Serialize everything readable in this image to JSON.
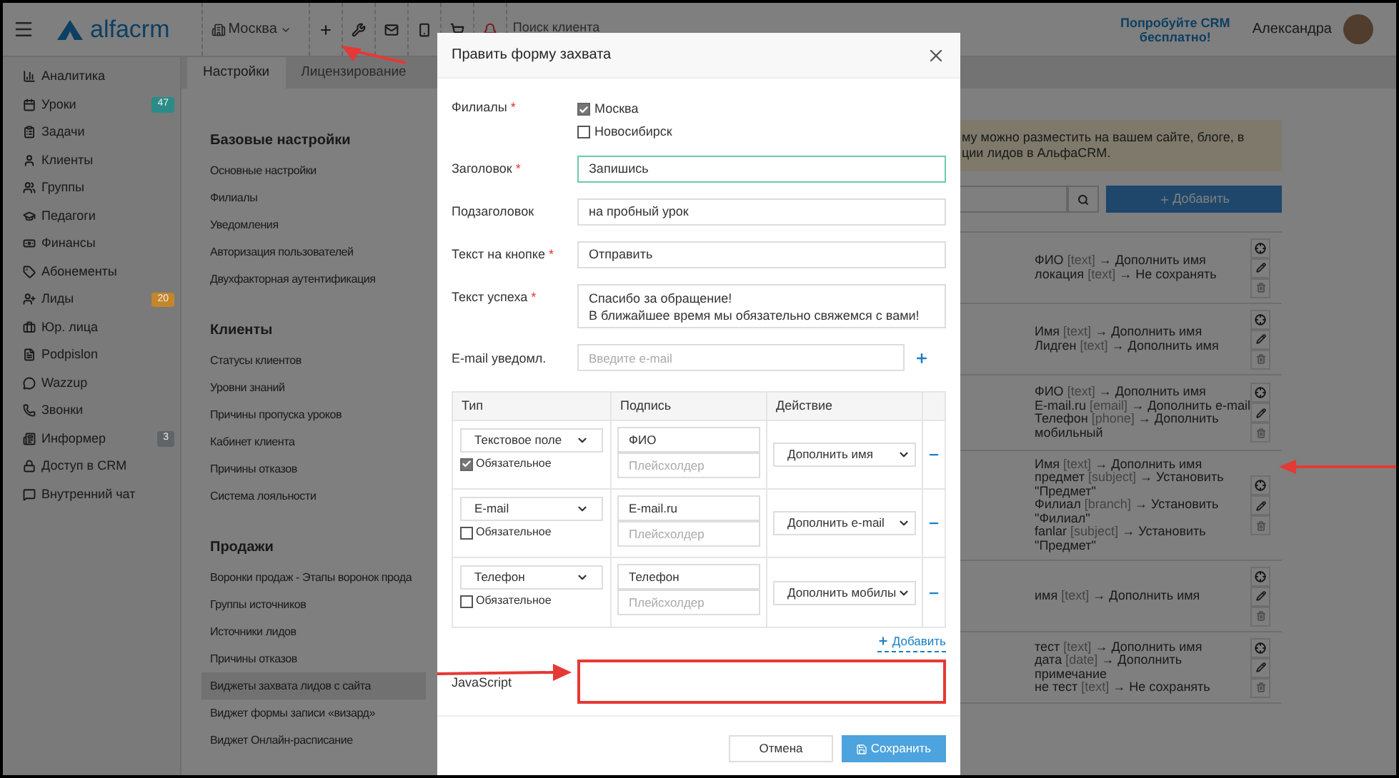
{
  "top_bar": {
    "logo": "alfacrm",
    "branch": "Москва",
    "search": {
      "placeholder": "Поиск клиента"
    },
    "promo": "Попробуйте CRM бесплатно!",
    "user": "Александра"
  },
  "sidebar": {
    "items": [
      {
        "label": "Аналитика"
      },
      {
        "label": "Уроки",
        "badge": "47",
        "color": "#2a8c86"
      },
      {
        "label": "Задачи"
      },
      {
        "label": "Клиенты"
      },
      {
        "label": "Группы"
      },
      {
        "label": "Педагоги"
      },
      {
        "label": "Финансы"
      },
      {
        "label": "Абонементы"
      },
      {
        "label": "Лиды",
        "badge": "20",
        "color": "#c5862a"
      },
      {
        "label": "Юр. лица"
      },
      {
        "label": "Podpislon"
      },
      {
        "label": "Wazzup"
      },
      {
        "label": "Звонки"
      },
      {
        "label": "Информер",
        "badge": "3",
        "color": "#5f6468"
      },
      {
        "label": "Доступ в CRM"
      },
      {
        "label": "Внутренний чат"
      }
    ]
  },
  "settings": {
    "tabs": [
      {
        "label": "Настройки",
        "selected": true
      },
      {
        "label": "Лицензирование",
        "selected": false
      }
    ],
    "sections": [
      {
        "title": "Базовые настройки",
        "items": [
          {
            "label": "Основные настройки",
            "selected": false
          },
          {
            "label": "Филиалы",
            "selected": false
          },
          {
            "label": "Уведомления",
            "selected": false
          },
          {
            "label": "Авторизация пользователей",
            "selected": false
          },
          {
            "label": "Двухфакторная аутентификация",
            "selected": false
          }
        ]
      },
      {
        "title": "Клиенты",
        "items": [
          {
            "label": "Статусы клиентов",
            "selected": false
          },
          {
            "label": "Уровни знаний",
            "selected": false
          },
          {
            "label": "Причины пропуска уроков",
            "selected": false
          },
          {
            "label": "Кабинет клиента",
            "selected": false
          },
          {
            "label": "Причины отказов",
            "selected": false
          },
          {
            "label": "Система лояльности",
            "selected": false
          }
        ]
      },
      {
        "title": "Продажи",
        "items": [
          {
            "label": "Воронки продаж - Этапы воронок прода",
            "selected": false
          },
          {
            "label": "Группы источников",
            "selected": false
          },
          {
            "label": "Источники лидов",
            "selected": false
          },
          {
            "label": "Причины отказов",
            "selected": false
          },
          {
            "label": "Виджеты захвата лидов с сайта",
            "selected": true
          },
          {
            "label": "Виджет формы записи «визард»",
            "selected": false
          },
          {
            "label": "Виджет Онлайн-расписание",
            "selected": false
          }
        ]
      }
    ]
  },
  "widgets": {
    "banner": [
      "му можно разместить на вашем сайте, блоге, в",
      "ции лидов в АльфаCRM."
    ],
    "add_button": "Добавить",
    "rows": [
      {
        "lines": [
          {
            "name": "ФИО",
            "type": "[text]",
            "action": "→ Дополнить имя"
          },
          {
            "name": "локация",
            "type": "[text]",
            "action": "→ Не сохранять"
          }
        ]
      },
      {
        "lines": [
          {
            "name": "Имя",
            "type": "[text]",
            "action": "→ Дополнить имя"
          },
          {
            "name": "Лидген",
            "type": "[text]",
            "action": "→ Дополнить имя"
          }
        ]
      },
      {
        "lines": [
          {
            "name": "ФИО",
            "type": "[text]",
            "action": "→ Дополнить имя"
          },
          {
            "name": "E-mail.ru",
            "type": "[email]",
            "action": "→ Дополнить e-mail"
          },
          {
            "name": "Телефон",
            "type": "[phone]",
            "action": "→ Дополнить мобильный"
          }
        ]
      },
      {
        "lines": [
          {
            "name": "Имя",
            "type": "[text]",
            "action": "→ Дополнить имя"
          },
          {
            "name": "предмет",
            "type": "[subject]",
            "action": "→ Установить \"Предмет\""
          },
          {
            "name": "Филиал",
            "type": "[branch]",
            "action": "→ Установить \"Филиал\""
          },
          {
            "name": "fanlar",
            "type": "[subject]",
            "action": "→ Установить \"Предмет\""
          }
        ]
      },
      {
        "lines": [
          {
            "name": "имя",
            "type": "[text]",
            "action": "→ Дополнить имя"
          }
        ]
      },
      {
        "lines": [
          {
            "name": "тест",
            "type": "[text]",
            "action": "→ Дополнить имя"
          },
          {
            "name": "дата",
            "type": "[date]",
            "action": "→ Дополнить примечание"
          },
          {
            "name": "не тест",
            "type": "[text]",
            "action": "→ Не сохранять"
          }
        ]
      }
    ]
  },
  "modal": {
    "title": "Править форму захвата",
    "fields": [
      {
        "kind": "checkboxes",
        "label": "Филиалы",
        "mark": "*",
        "options": [
          {
            "label": "Москва",
            "checked": true
          },
          {
            "label": "Новосибирск",
            "checked": false
          }
        ]
      },
      {
        "kind": "input",
        "label": "Заголовок",
        "mark": "*",
        "value": "Запишись",
        "focused": true
      },
      {
        "kind": "input",
        "label": "Подзаголовок",
        "value": "на пробный урок",
        "focused": false
      },
      {
        "kind": "input",
        "label": "Текст на кнопке",
        "mark": "*",
        "value": "Отправить",
        "focused": false
      },
      {
        "kind": "textarea",
        "label": "Текст успеха",
        "mark": "*",
        "lines": [
          "Спасибо за обращение!",
          "В ближайшее время мы обязательно свяжемся с вами!"
        ]
      },
      {
        "kind": "email",
        "label": "E-mail уведомл.",
        "placeholder": "Введите e-mail"
      }
    ],
    "table": {
      "columns": [
        "Тип",
        "Подпись",
        "Действие"
      ],
      "rows": [
        {
          "type": "Текстовое поле",
          "required_label": "Обязательное",
          "required": true,
          "label": "ФИО",
          "placeholder": "Плейсхолдер",
          "action": "Дополнить имя"
        },
        {
          "type": "E-mail",
          "required_label": "Обязательное",
          "required": false,
          "label": "E-mail.ru",
          "placeholder": "Плейсхолдер",
          "action": "Дополнить e-mail"
        },
        {
          "type": "Телефон",
          "required_label": "Обязательное",
          "required": false,
          "label": "Телефон",
          "placeholder": "Плейсхолдер",
          "action": "Дополнить мобилы"
        }
      ]
    },
    "add_link": "Добавить",
    "javascript_label": "JavaScript",
    "buttons": {
      "cancel": "Отмена",
      "save": "Сохранить"
    }
  }
}
